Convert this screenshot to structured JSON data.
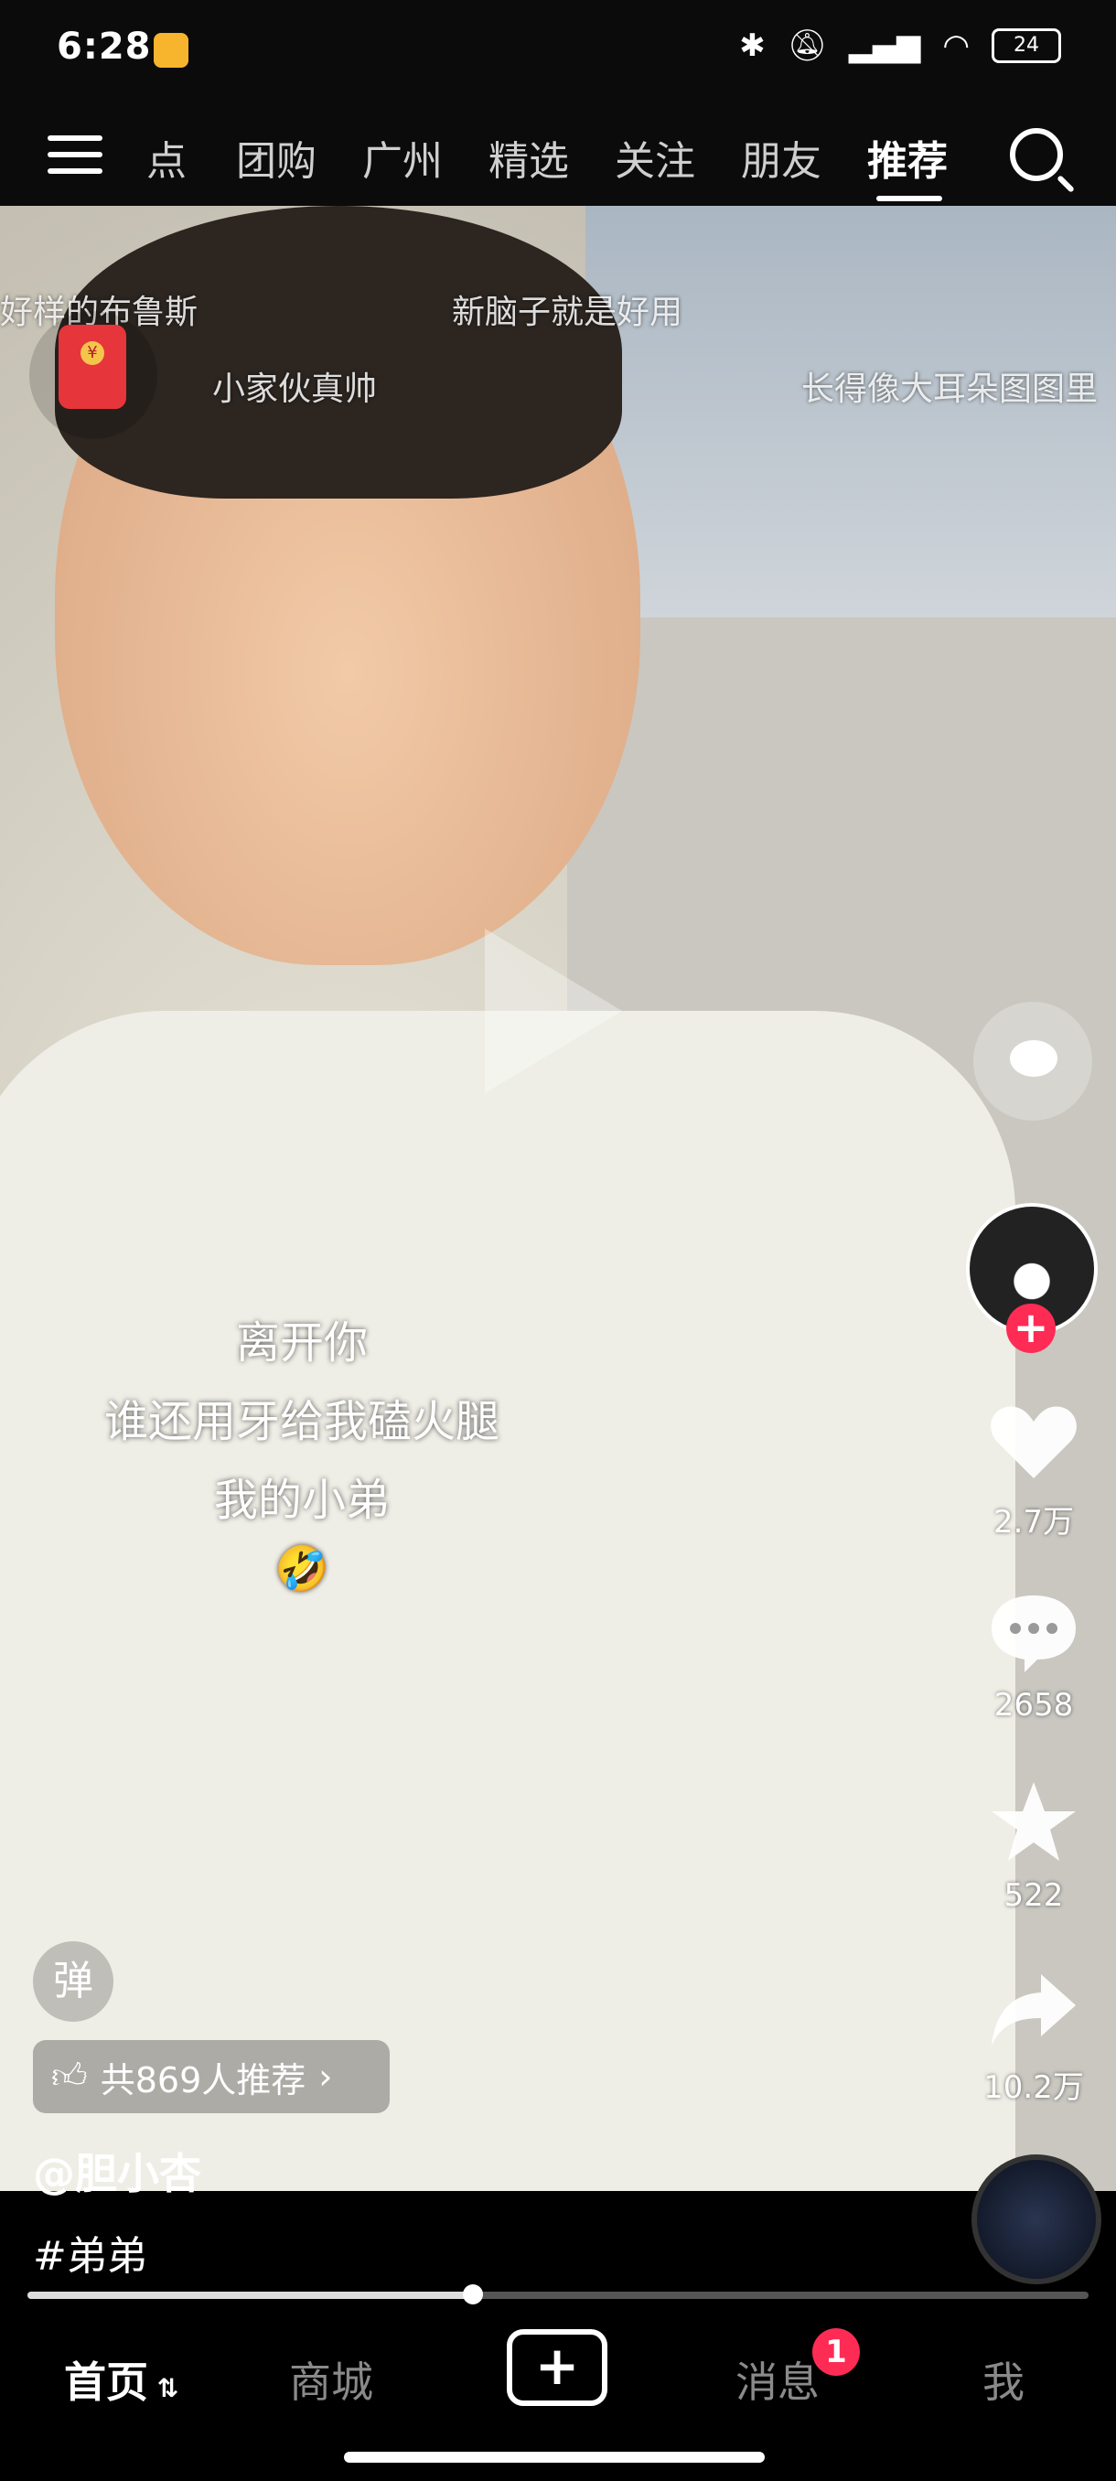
{
  "status_bar": {
    "time": "6:28",
    "battery": "24"
  },
  "top_tabs": [
    "点",
    "团购",
    "广州",
    "精选",
    "关注",
    "朋友",
    "推荐"
  ],
  "active_tab": "推荐",
  "danmaku": [
    "好样的布鲁斯",
    "新脑子就是好用",
    "小家伙真帅",
    "长得像大耳朵图图里"
  ],
  "caption": {
    "line1": "离开你",
    "line2": "谁还用牙给我磕火腿",
    "line3": "我的小弟",
    "emoji": "🤣"
  },
  "actions": {
    "likes": "2.7万",
    "comments": "2658",
    "favorites": "522",
    "shares": "10.2万"
  },
  "danmu_toggle": "弹",
  "recommend": "共869人推荐",
  "author": "@胆小杏",
  "hashtag": "#弟弟",
  "progress": 0.42,
  "bottom_nav": {
    "home": "首页",
    "mall": "商城",
    "messages": "消息",
    "me": "我",
    "badge": "1"
  },
  "colors": {
    "accent": "#fe2c55"
  }
}
